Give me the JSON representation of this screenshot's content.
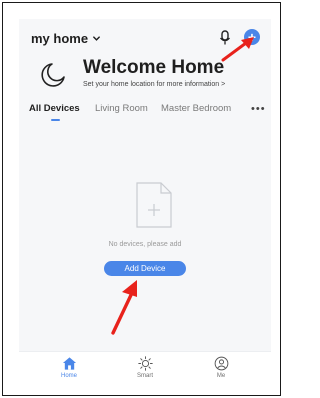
{
  "header": {
    "home_name": "my home",
    "add_icon_glyph": "+"
  },
  "welcome": {
    "title": "Welcome Home",
    "subtitle": "Set your home location for more information >"
  },
  "tabs": [
    {
      "label": "All Devices",
      "active": true
    },
    {
      "label": "Living Room",
      "active": false
    },
    {
      "label": "Master Bedroom",
      "active": false
    }
  ],
  "more_icon_glyph": "•••",
  "empty_state": {
    "message": "No devices, please add",
    "button_label": "Add Device"
  },
  "bottom_nav": [
    {
      "label": "Home",
      "icon": "home-icon",
      "active": true
    },
    {
      "label": "Smart",
      "icon": "sun-icon",
      "active": false
    },
    {
      "label": "Me",
      "icon": "profile-icon",
      "active": false
    }
  ],
  "colors": {
    "accent": "#4a86e8",
    "arrow": "#e8221c"
  }
}
